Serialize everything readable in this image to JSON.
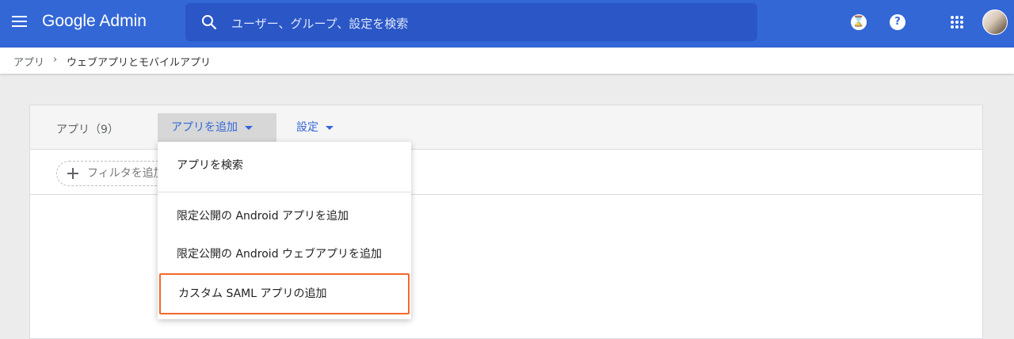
{
  "header": {
    "logo": "Google Admin",
    "search_placeholder": "ユーザー、グループ、設定を検索",
    "icons": [
      "menu-icon",
      "search-icon",
      "hourglass-icon",
      "help-icon",
      "apps-grid-icon",
      "avatar"
    ],
    "hourglass_glyph": "⌛",
    "help_glyph": "?"
  },
  "breadcrumb": {
    "root": "アプリ",
    "separator": "›",
    "current": "ウェブアプリとモバイルアプリ"
  },
  "toolbar": {
    "apps_count": "アプリ（9）",
    "add_app_label": "アプリを追加",
    "settings_label": "設定"
  },
  "filter": {
    "label": "フィルタを追加"
  },
  "menu": {
    "items": [
      "アプリを検索",
      "限定公開の Android アプリを追加",
      "限定公開の Android ウェブアプリを追加",
      "カスタム SAML アプリの追加"
    ],
    "highlighted_index": 3
  },
  "colors": {
    "header_blue": "#3367d6",
    "search_blue": "#2a56c6",
    "highlight": "#f4682c"
  }
}
